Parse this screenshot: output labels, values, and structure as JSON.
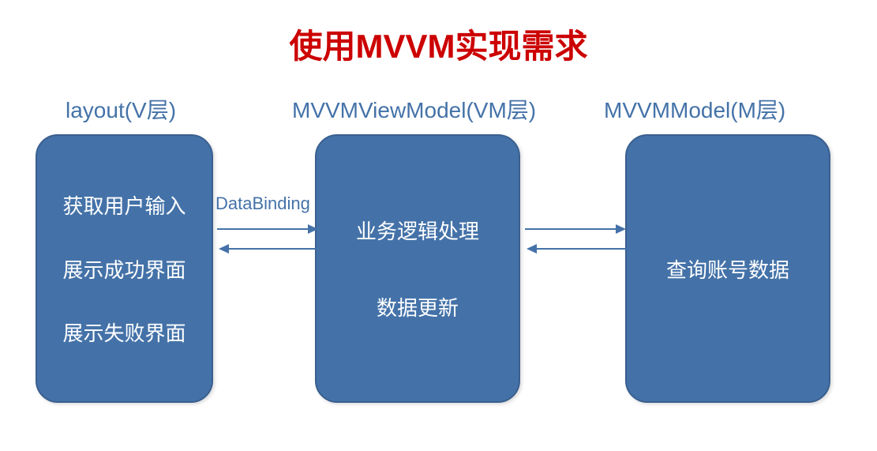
{
  "title": "使用MVVM实现需求",
  "labels": {
    "v": "layout(V层)",
    "vm": "MVVMViewModel(VM层)",
    "m": "MVVMModel(M层)"
  },
  "boxes": {
    "v": {
      "item1": "获取用户输入",
      "item2": "展示成功界面",
      "item3": "展示失败界面"
    },
    "vm": {
      "item1": "业务逻辑处理",
      "item2": "数据更新"
    },
    "m": {
      "item1": "查询账号数据"
    }
  },
  "arrows": {
    "databinding": "DataBinding"
  },
  "colors": {
    "title": "#cc0000",
    "box": "#4472a8",
    "label": "#4472a8"
  }
}
